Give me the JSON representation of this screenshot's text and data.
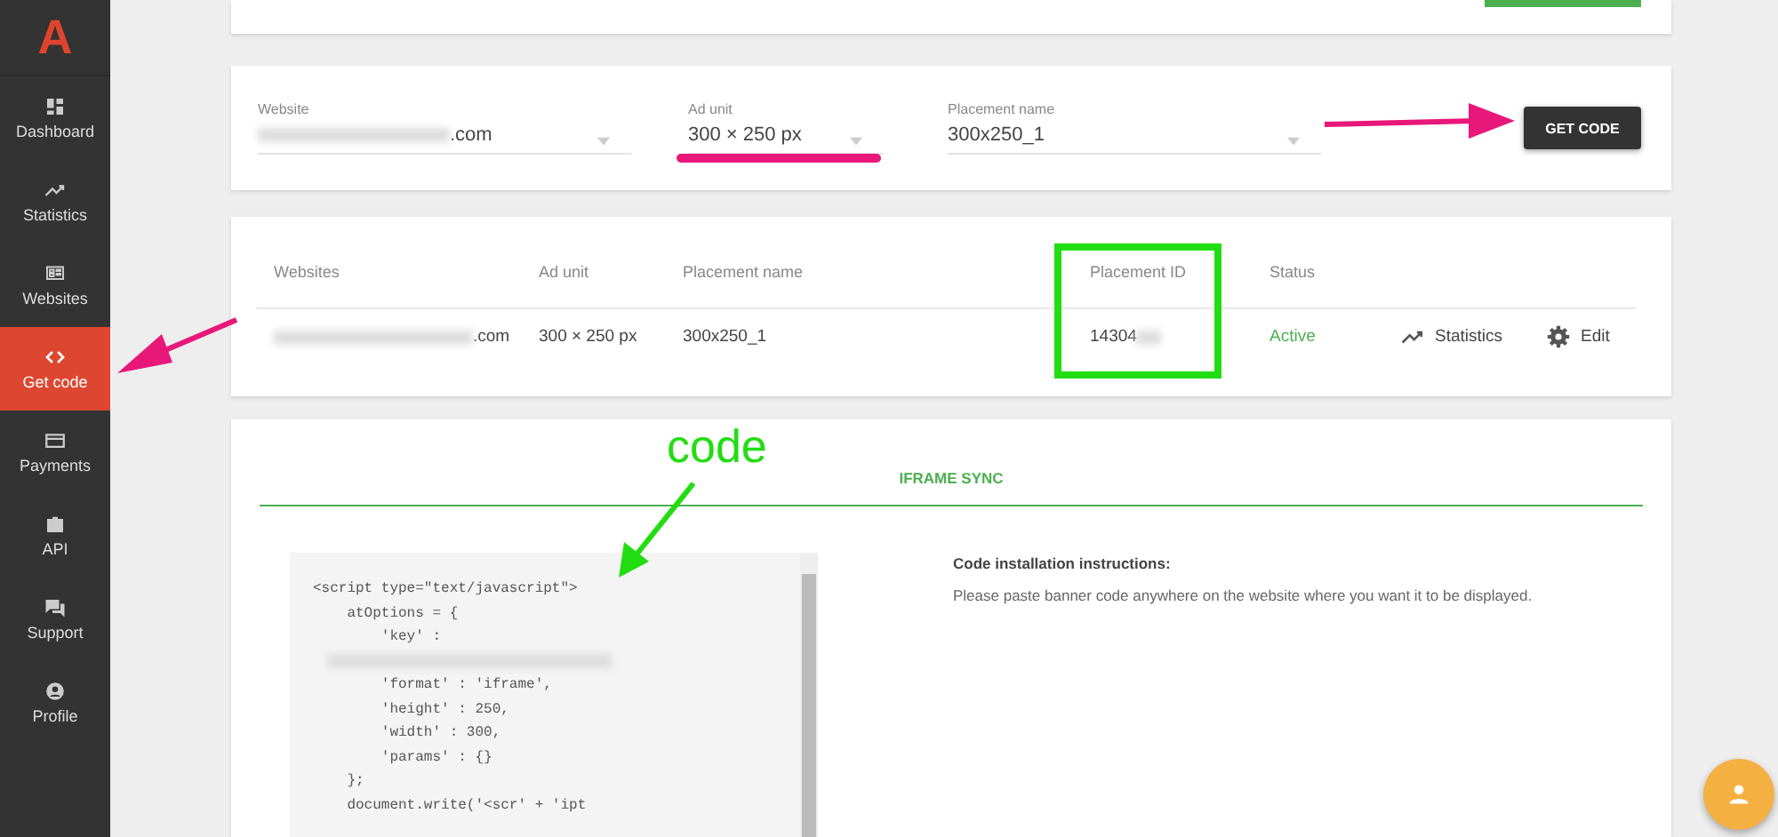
{
  "sidebar": {
    "logo": "A",
    "items": [
      {
        "label": "Dashboard",
        "selected": false
      },
      {
        "label": "Statistics",
        "selected": false
      },
      {
        "label": "Websites",
        "selected": false
      },
      {
        "label": "Get code",
        "selected": true
      },
      {
        "label": "Payments",
        "selected": false
      },
      {
        "label": "API",
        "selected": false
      },
      {
        "label": "Support",
        "selected": false
      },
      {
        "label": "Profile",
        "selected": false
      }
    ]
  },
  "form": {
    "fields": [
      {
        "label": "Website",
        "value": ".com",
        "redacted": true
      },
      {
        "label": "Ad unit",
        "value": "300 × 250 px",
        "redacted": false
      },
      {
        "label": "Placement name",
        "value": "300x250_1",
        "redacted": false
      }
    ],
    "button": "GET CODE"
  },
  "table": {
    "columns": [
      "Websites",
      "Ad unit",
      "Placement name",
      "Placement ID",
      "Status"
    ],
    "rows": [
      {
        "website": ".com",
        "ad_unit": "300 × 250 px",
        "placement_name": "300x250_1",
        "placement_id": "14304",
        "status": "Active",
        "actions": [
          "Statistics",
          "Edit"
        ]
      }
    ]
  },
  "code_panel": {
    "tab": "IFRAME SYNC",
    "code_lines": [
      {
        "kind": "text",
        "text": "<script type=\"text/javascript\">"
      },
      {
        "kind": "text",
        "text": "\tatOptions = {"
      },
      {
        "kind": "text",
        "text": "\t\t'key' :"
      },
      {
        "kind": "redacted"
      },
      {
        "kind": "text",
        "text": "\t\t'format' : 'iframe',"
      },
      {
        "kind": "text",
        "text": "\t\t'height' : 250,"
      },
      {
        "kind": "text",
        "text": "\t\t'width' : 300,"
      },
      {
        "kind": "text",
        "text": "\t\t'params' : {}"
      },
      {
        "kind": "text",
        "text": "\t};"
      },
      {
        "kind": "text",
        "text": "\tdocument.write('<scr' + 'ipt"
      }
    ],
    "instructions_title": "Code installation instructions:",
    "instructions": "Please paste banner code anywhere on the website where you want it to be displayed."
  },
  "annotation": {
    "label": "code"
  }
}
